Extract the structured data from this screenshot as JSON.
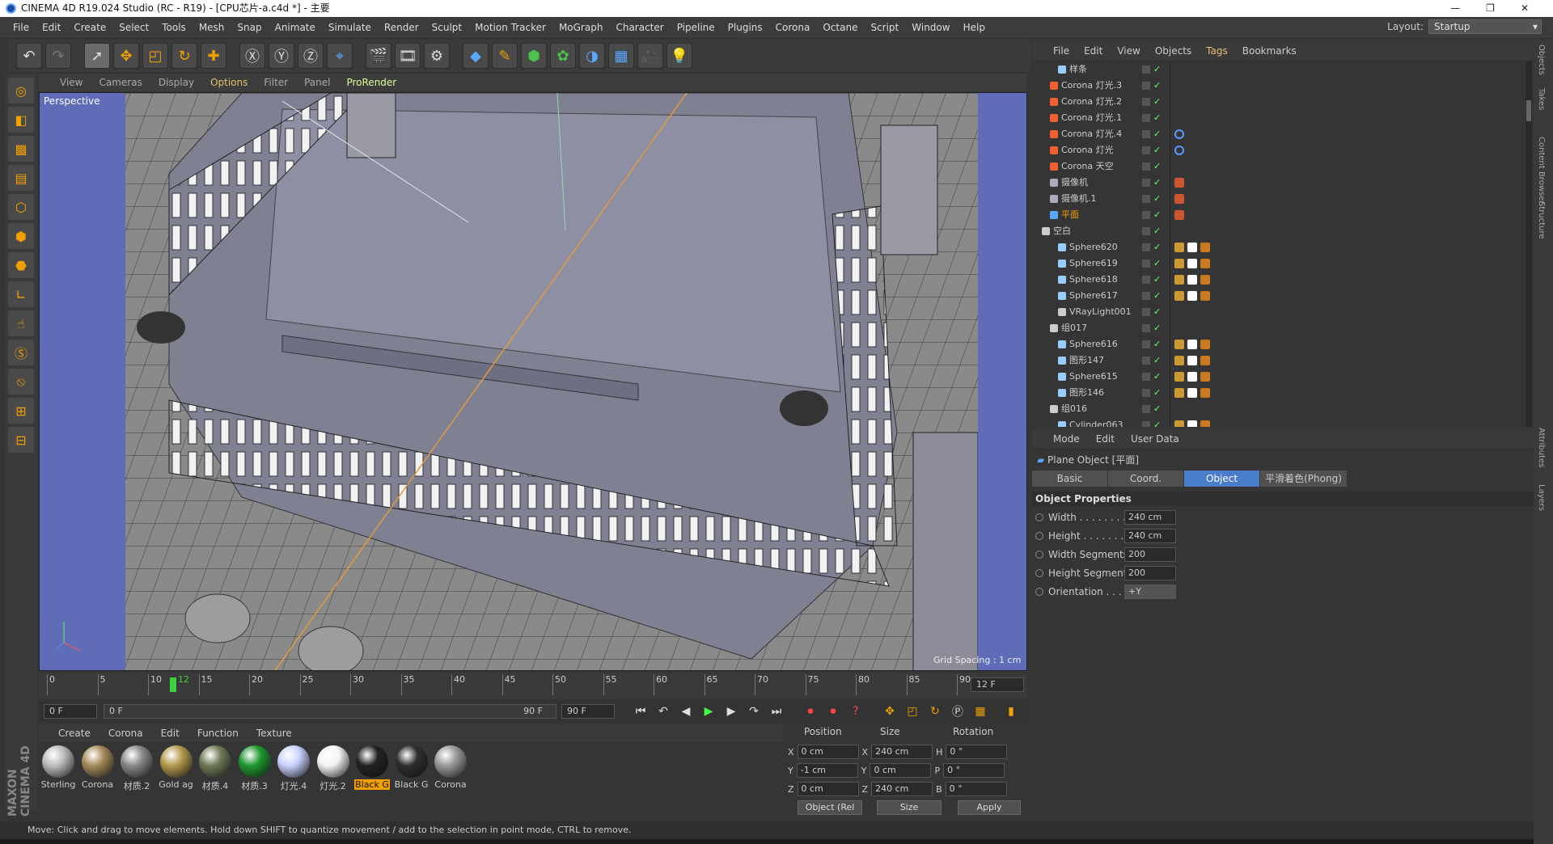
{
  "window": {
    "title": "CINEMA 4D R19.024 Studio (RC - R19) - [CPU芯片-a.c4d *] - 主要",
    "controls": [
      "—",
      "❐",
      "✕"
    ]
  },
  "menubar": [
    "File",
    "Edit",
    "Create",
    "Select",
    "Tools",
    "Mesh",
    "Snap",
    "Animate",
    "Simulate",
    "Render",
    "Sculpt",
    "Motion Tracker",
    "MoGraph",
    "Character",
    "Pipeline",
    "Plugins",
    "Corona",
    "Octane",
    "Script",
    "Window",
    "Help"
  ],
  "layout": {
    "label": "Layout:",
    "value": "Startup"
  },
  "viewport": {
    "menu": [
      "View",
      "Cameras",
      "Display",
      "Options",
      "Filter",
      "Panel",
      "ProRender"
    ],
    "highlight": "Options",
    "label": "Perspective",
    "grid_spacing": "Grid Spacing : 1 cm"
  },
  "timeline": {
    "ticks": [
      "0",
      "5",
      "10",
      "15",
      "20",
      "25",
      "30",
      "35",
      "40",
      "45",
      "50",
      "55",
      "60",
      "65",
      "70",
      "75",
      "80",
      "85",
      "90"
    ],
    "current_frame": "12",
    "frame_field": "12 F",
    "start": "0 F",
    "range_start": "0 F",
    "range_end": "90 F",
    "end": "90 F"
  },
  "materials": {
    "menu": [
      "Create",
      "Corona",
      "Edit",
      "Function",
      "Texture"
    ],
    "items": [
      {
        "label": "Sterling",
        "color": "#bdbdbd"
      },
      {
        "label": "Corona",
        "color": "#a58b5a"
      },
      {
        "label": "材质.2",
        "color": "#8a8a8a"
      },
      {
        "label": "Gold ag",
        "color": "#b39a4d"
      },
      {
        "label": "材质.4",
        "color": "#6f7a55"
      },
      {
        "label": "材质.3",
        "color": "#1f9a2f"
      },
      {
        "label": "灯光.4",
        "color": "#c9d2ff"
      },
      {
        "label": "灯光.2",
        "color": "#f4f4f4"
      },
      {
        "label": "Black G",
        "color": "#222222"
      },
      {
        "label": "Black G",
        "color": "#2e2e2e"
      },
      {
        "label": "Corona",
        "color": "#9a9a9a"
      }
    ],
    "selected_index": 8
  },
  "coords": {
    "headers": [
      "Position",
      "Size",
      "Rotation"
    ],
    "rows": [
      {
        "a": "X",
        "pos": "0 cm",
        "b": "X",
        "size": "240 cm",
        "c": "H",
        "rot": "0 °"
      },
      {
        "a": "Y",
        "pos": "-1 cm",
        "b": "Y",
        "size": "0 cm",
        "c": "P",
        "rot": "0 °"
      },
      {
        "a": "Z",
        "pos": "0 cm",
        "b": "Z",
        "size": "240 cm",
        "c": "B",
        "rot": "0 °"
      }
    ],
    "mode": "Object (Rel",
    "size_mode": "Size",
    "apply": "Apply"
  },
  "status": "Move: Click and drag to move elements. Hold down SHIFT to quantize movement / add to the selection in point mode, CTRL to remove.",
  "objects": {
    "menu": [
      "File",
      "Edit",
      "View",
      "Objects",
      "Tags",
      "Bookmarks"
    ],
    "highlight": "Tags",
    "rows": [
      {
        "name": "样条",
        "indent": 2,
        "icon": "spline"
      },
      {
        "name": "Corona 灯光.3",
        "indent": 1,
        "icon": "light"
      },
      {
        "name": "Corona 灯光.2",
        "indent": 1,
        "icon": "light"
      },
      {
        "name": "Corona 灯光.1",
        "indent": 1,
        "icon": "light"
      },
      {
        "name": "Corona 灯光.4",
        "indent": 1,
        "icon": "light"
      },
      {
        "name": "Corona 灯光",
        "indent": 1,
        "icon": "light"
      },
      {
        "name": "Corona 天空",
        "indent": 1,
        "icon": "sky"
      },
      {
        "name": "摄像机",
        "indent": 1,
        "icon": "camera"
      },
      {
        "name": "摄像机.1",
        "indent": 1,
        "icon": "camera"
      },
      {
        "name": "平面",
        "indent": 1,
        "icon": "plane"
      },
      {
        "name": "空白",
        "indent": 0,
        "icon": "null"
      },
      {
        "name": "Sphere620",
        "indent": 2,
        "icon": "mesh"
      },
      {
        "name": "Sphere619",
        "indent": 2,
        "icon": "mesh"
      },
      {
        "name": "Sphere618",
        "indent": 2,
        "icon": "mesh"
      },
      {
        "name": "Sphere617",
        "indent": 2,
        "icon": "mesh"
      },
      {
        "name": "VRayLight001",
        "indent": 2,
        "icon": "null"
      },
      {
        "name": "组017",
        "indent": 1,
        "icon": "null"
      },
      {
        "name": "Sphere616",
        "indent": 2,
        "icon": "mesh"
      },
      {
        "name": "图形147",
        "indent": 2,
        "icon": "mesh"
      },
      {
        "name": "Sphere615",
        "indent": 2,
        "icon": "mesh"
      },
      {
        "name": "图形146",
        "indent": 2,
        "icon": "mesh"
      },
      {
        "name": "组016",
        "indent": 1,
        "icon": "null"
      },
      {
        "name": "Cylinder063",
        "indent": 2,
        "icon": "mesh"
      }
    ]
  },
  "attributes": {
    "menu": [
      "Mode",
      "Edit",
      "User Data"
    ],
    "title": "Plane Object [平面]",
    "tabs": [
      "Basic",
      "Coord.",
      "Object",
      "平滑着色(Phong)"
    ],
    "active_tab": "Object",
    "section": "Object Properties",
    "props": [
      {
        "label": "Width . . . . . . . . . .",
        "value": "240 cm"
      },
      {
        "label": "Height . . . . . . . . .",
        "value": "240 cm"
      },
      {
        "label": "Width Segments",
        "value": "200"
      },
      {
        "label": "Height Segments",
        "value": "200"
      },
      {
        "label": "Orientation . . . . .",
        "value": "+Y"
      }
    ]
  },
  "side_tabs": [
    "Objects",
    "Takes",
    "Content Browser",
    "Structure",
    "Attributes",
    "Layers"
  ],
  "colors": {
    "accent": "#4a7dc9",
    "select": "#f0a000",
    "viewport": "#5f6cb8"
  }
}
